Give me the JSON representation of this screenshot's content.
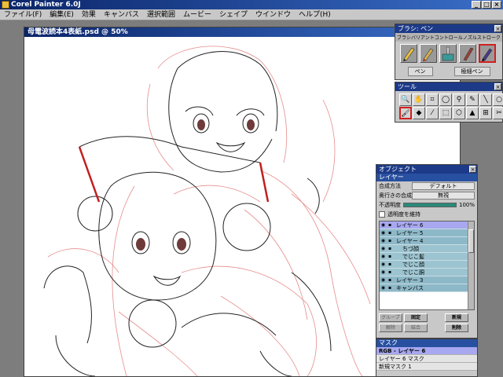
{
  "app": {
    "title": "Corel Painter 6.0J"
  },
  "menu": [
    "ファイル(F)",
    "編集(E)",
    "効果",
    "キャンバス",
    "選択範囲",
    "ムービー",
    "シェイプ",
    "ウインドウ",
    "ヘルプ(H)"
  ],
  "document": {
    "title": "母電波読本4表紙.psd @ 50%"
  },
  "brush_palette": {
    "title": "ブラシ: ペン",
    "tabs": [
      "ブラシ",
      "バリアント",
      "コントロール",
      "ノズル",
      "ストローク"
    ],
    "brushes": [
      "pencil-icon",
      "pen-icon",
      "watercolor-icon",
      "calligraphy-icon",
      "ink-pen-icon"
    ],
    "selected_index": 4,
    "category": "ペン",
    "variant": "極細ペン"
  },
  "tools_palette": {
    "title": "ツール",
    "tools": [
      "magnifier-icon",
      "grabber-icon",
      "crop-icon",
      "lasso-icon",
      "magic-wand-icon",
      "pen-tool-icon",
      "line-icon",
      "oval-icon",
      "brush-icon",
      "bucket-icon",
      "dropper-icon",
      "rect-select-icon",
      "transform-icon",
      "3d-icon",
      "layer-adjuster-icon",
      "scissors-icon"
    ],
    "selected_index": 8
  },
  "objects_palette": {
    "title": "オブジェクト",
    "layer_section": "レイヤー",
    "composite_method_label": "合成方法",
    "composite_method": "デフォルト",
    "depth_label": "奥行きの合成",
    "depth_value": "無視",
    "opacity_label": "不透明度",
    "opacity_value": "100%",
    "opacity_fraction": 1.0,
    "preserve_label": "透明度を維持",
    "layers": [
      {
        "name": "レイヤー 6",
        "selected": true,
        "group": false
      },
      {
        "name": "レイヤー 5",
        "selected": false,
        "group": false
      },
      {
        "name": "レイヤー 4",
        "selected": false,
        "group": false
      },
      {
        "name": "ちづ顔",
        "selected": false,
        "group": true
      },
      {
        "name": "でじこ髪",
        "selected": false,
        "group": true
      },
      {
        "name": "でじこ顔",
        "selected": false,
        "group": true
      },
      {
        "name": "でじこ胴",
        "selected": false,
        "group": true
      },
      {
        "name": "レイヤー 3",
        "selected": false,
        "group": false
      },
      {
        "name": "キャンバス",
        "selected": false,
        "group": false
      }
    ],
    "buttons": {
      "group": "グループ",
      "fix": "固定",
      "new": "新規",
      "ungroup": "解除",
      "merge": "結合",
      "delete": "削除"
    },
    "mask_section": "マスク",
    "masks": [
      {
        "name": "RGB - レイヤー 6",
        "selected": true
      },
      {
        "name": "レイヤー 6 マスク",
        "selected": false
      },
      {
        "name": "新規マスク 1",
        "selected": false
      }
    ]
  }
}
